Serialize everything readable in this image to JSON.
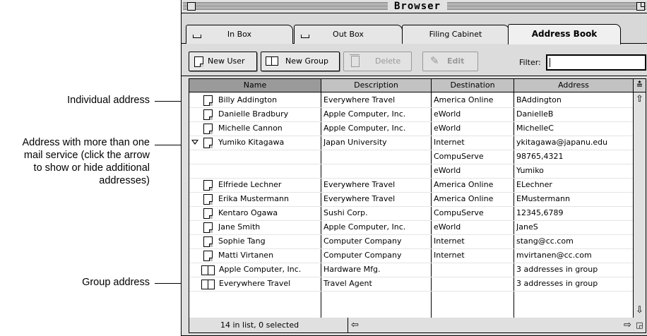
{
  "callouts": {
    "individual": "Individual address",
    "multi_line1": "Address with more than one",
    "multi_line2": "mail service (click the arrow",
    "multi_line3": "to show or hide additional",
    "multi_line4": "addresses)",
    "group": "Group address"
  },
  "window": {
    "title": "Browser"
  },
  "tabs": [
    "In Box",
    "Out Box",
    "Filing Cabinet",
    "Address Book"
  ],
  "toolbar": {
    "new_user": "New User",
    "new_group": "New Group",
    "delete": "Delete",
    "edit": "Edit",
    "filter_label": "Filter:",
    "filter_value": ""
  },
  "columns": [
    "Name",
    "Description",
    "Destination",
    "Address"
  ],
  "rows": [
    {
      "type": "individual",
      "name": "Billy Addington",
      "description": "Everywhere Travel",
      "destination": "America Online",
      "address": "BAddington"
    },
    {
      "type": "individual",
      "name": "Danielle Bradbury",
      "description": "Apple Computer, Inc.",
      "destination": "eWorld",
      "address": "DanielleB"
    },
    {
      "type": "individual",
      "name": "Michelle Cannon",
      "description": "Apple Computer, Inc.",
      "destination": "eWorld",
      "address": "MichelleC"
    },
    {
      "type": "individual",
      "expanded": true,
      "name": "Yumiko Kitagawa",
      "description": "Japan University",
      "destination": "Internet",
      "address": "ykitagawa@japanu.edu"
    },
    {
      "type": "sub",
      "name": "",
      "description": "",
      "destination": "CompuServe",
      "address": "98765,4321"
    },
    {
      "type": "sub",
      "name": "",
      "description": "",
      "destination": "eWorld",
      "address": "Yumiko"
    },
    {
      "type": "individual",
      "name": "Elfriede Lechner",
      "description": "Everywhere Travel",
      "destination": "America Online",
      "address": "ELechner"
    },
    {
      "type": "individual",
      "name": "Erika Mustermann",
      "description": "Everywhere Travel",
      "destination": "America Online",
      "address": "EMustermann"
    },
    {
      "type": "individual",
      "name": "Kentaro Ogawa",
      "description": "Sushi Corp.",
      "destination": "CompuServe",
      "address": "12345,6789"
    },
    {
      "type": "individual",
      "name": "Jane Smith",
      "description": "Apple Computer, Inc.",
      "destination": "eWorld",
      "address": "JaneS"
    },
    {
      "type": "individual",
      "name": "Sophie Tang",
      "description": "Computer Company",
      "destination": "Internet",
      "address": "stang@cc.com"
    },
    {
      "type": "individual",
      "name": "Matti Virtanen",
      "description": "Computer Company",
      "destination": "Internet",
      "address": "mvirtanen@cc.com"
    },
    {
      "type": "group",
      "name": "Apple Computer, Inc.",
      "description": "Hardware Mfg.",
      "destination": "",
      "address": "3 addresses in group"
    },
    {
      "type": "group",
      "name": "Everywhere Travel",
      "description": "Travel Agent",
      "destination": "",
      "address": "3 addresses in group"
    }
  ],
  "status": "14 in list, 0 selected"
}
